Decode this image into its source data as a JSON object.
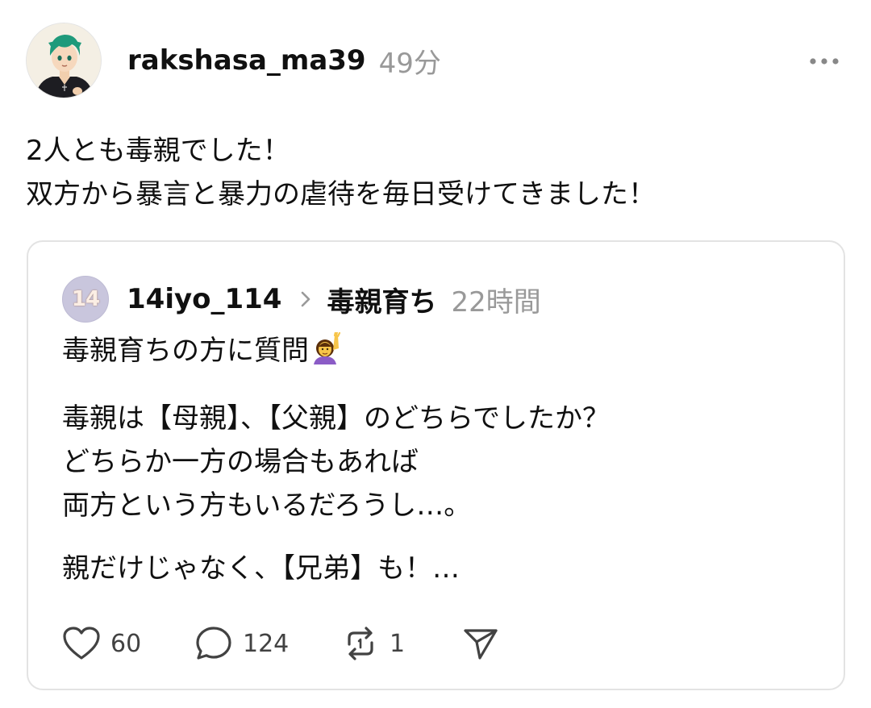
{
  "post": {
    "username": "rakshasa_ma39",
    "timestamp": "49分",
    "more_icon": "more-horizontal-icon",
    "text_lines": [
      "2人とも毒親でした！",
      "双方から暴言と暴力の虐待を毎日受けてきました！"
    ]
  },
  "quoted_post": {
    "avatar_text": "14",
    "username": "14iyo_114",
    "topic": "毒親育ち",
    "timestamp": "22時間",
    "paragraphs": [
      {
        "lines": [
          "毒親育ちの方に質問"
        ]
      },
      {
        "lines": [
          "毒親は【母親】、【父親】のどちらでしたか？",
          "どちらか一方の場合もあれば",
          "両方という方もいるだろうし…。"
        ]
      },
      {
        "lines": [
          "親だけじゃなく、【兄弟】も！…"
        ]
      }
    ],
    "actions": {
      "like_count": "60",
      "reply_count": "124",
      "repost_count": "1"
    }
  },
  "colors": {
    "text": "#101010",
    "muted": "#999999",
    "border": "#e3e3e3",
    "icon": "#424242"
  }
}
